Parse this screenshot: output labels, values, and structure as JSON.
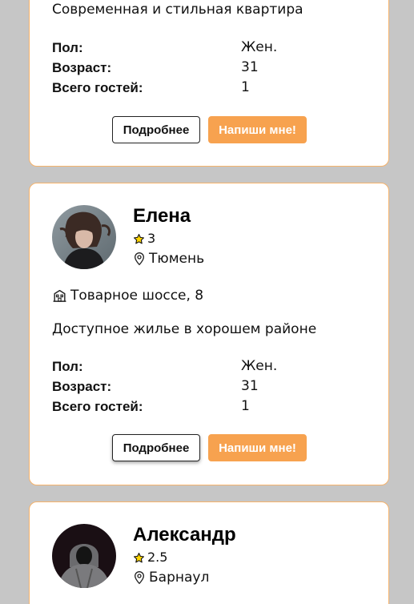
{
  "cards": [
    {
      "description": "Современная и стильная квартира",
      "stats": [
        {
          "label": "Пол:",
          "value": "Жен."
        },
        {
          "label": "Возраст:",
          "value": "31"
        },
        {
          "label": "Всего гостей:",
          "value": "1"
        }
      ],
      "more_label": "Подробнее",
      "write_label": "Напиши мне!"
    },
    {
      "name": "Елена",
      "rating": "3",
      "city": "Тюмень",
      "address": "Товарное шоссе, 8",
      "description": "Доступное жилье в хорошем районе",
      "stats": [
        {
          "label": "Пол:",
          "value": "Жен."
        },
        {
          "label": "Возраст:",
          "value": "31"
        },
        {
          "label": "Всего гостей:",
          "value": "1"
        }
      ],
      "more_label": "Подробнее",
      "write_label": "Напиши мне!"
    },
    {
      "name": "Александр",
      "rating": "2.5",
      "city": "Барнаул"
    }
  ],
  "colors": {
    "accent": "#f7a24f",
    "card_border": "#f6b36b",
    "background": "#c6c6c6",
    "star": "#ffd600"
  },
  "icons": {
    "rating": "star-icon",
    "city": "location-pin-icon",
    "address": "building-icon"
  }
}
